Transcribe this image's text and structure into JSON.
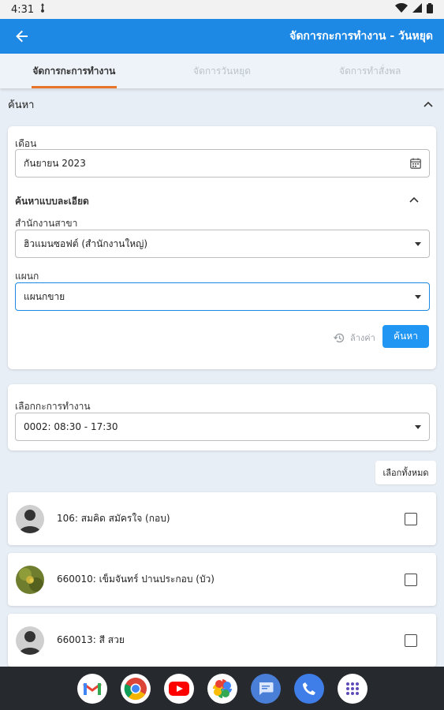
{
  "status": {
    "time": "4:31"
  },
  "app_bar": {
    "title": "จัดการกะการทำงาน - วันหยุด"
  },
  "tabs": [
    {
      "label": "จัดการกะการทำงาน"
    },
    {
      "label": "จัดการวันหยุด"
    },
    {
      "label": "จัดการทำสั่งพล"
    }
  ],
  "search": {
    "header": "ค้นหา",
    "month_label": "เดือน",
    "month_value": "กันยายน 2023",
    "advanced_label": "ค้นหาแบบละเอียด",
    "branch_label": "สำนักงานสาขา",
    "branch_value": "ฮิวแมนซอฟต์ (สำนักงานใหญ่)",
    "department_label": "แผนก",
    "department_value": "แผนกขาย",
    "reset_label": "ล้างค่า",
    "search_button": "ค้นหา"
  },
  "shift": {
    "label": "เลือกกะการทำงาน",
    "value": "0002: 08:30 - 17:30"
  },
  "select_all_label": "เลือกทั้งหมด",
  "employees": [
    {
      "name": "106: สมคิด สมัครใจ (กอบ)"
    },
    {
      "name": "660010: เข็มจันทร์ ปานประกอบ (บัว)"
    },
    {
      "name": "660013: สี สวย"
    }
  ]
}
